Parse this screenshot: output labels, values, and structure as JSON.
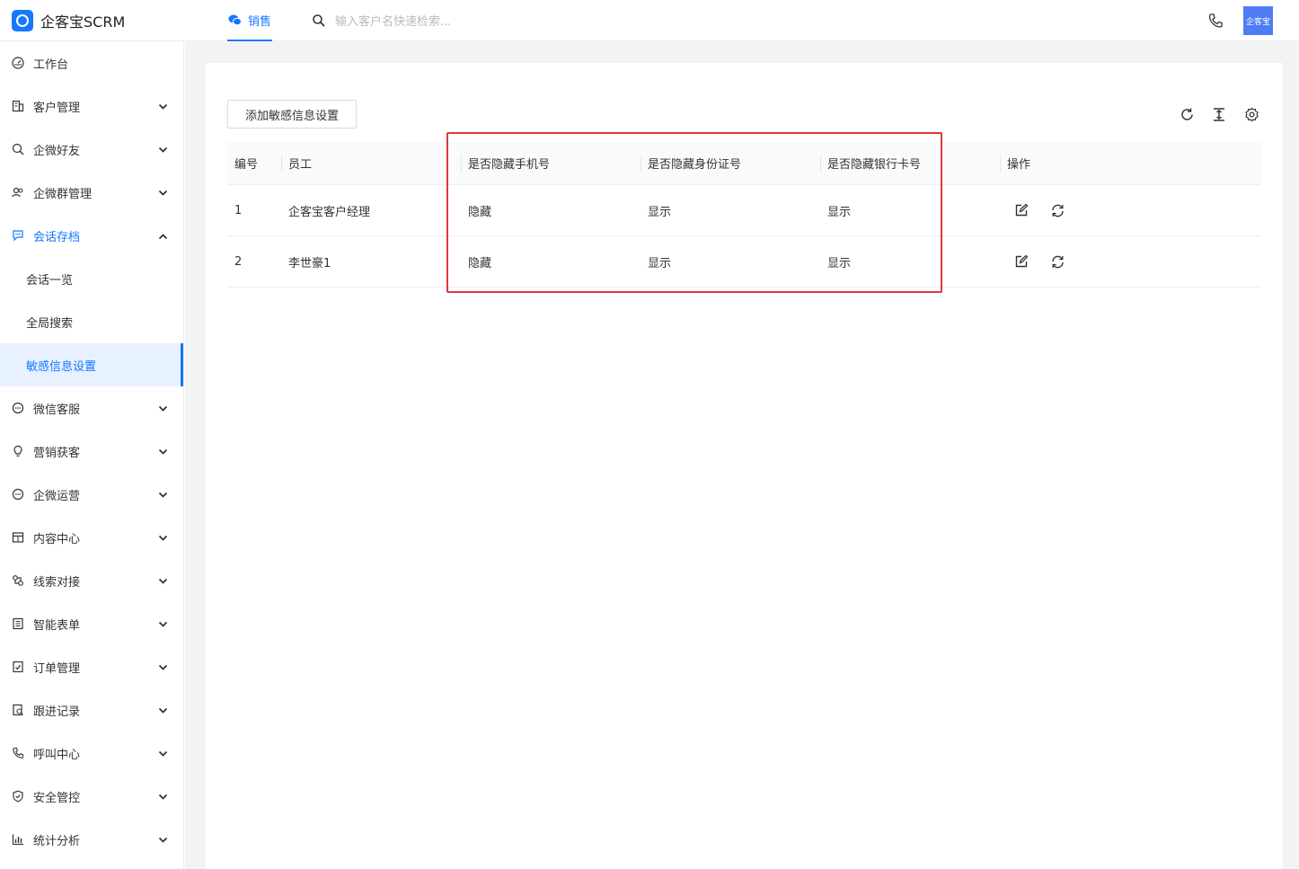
{
  "app": {
    "title": "企客宝SCRM",
    "nav_tab": "销售",
    "search_placeholder": "输入客户名快速检索...",
    "avatar_text": "企客宝",
    "accent_color": "#1677ff",
    "highlight_color": "#e0373a"
  },
  "sidebar": {
    "items": [
      {
        "label": "工作台",
        "icon": "dashboard-icon",
        "has_chevron": false
      },
      {
        "label": "客户管理",
        "icon": "building-icon",
        "has_chevron": true
      },
      {
        "label": "企微好友",
        "icon": "chat-search-icon",
        "has_chevron": true
      },
      {
        "label": "企微群管理",
        "icon": "group-icon",
        "has_chevron": true
      },
      {
        "label": "会话存档",
        "icon": "conversation-icon",
        "has_chevron": true,
        "expanded": true
      },
      {
        "label": "会话一览",
        "sub": true
      },
      {
        "label": "全局搜索",
        "sub": true
      },
      {
        "label": "敏感信息设置",
        "sub": true,
        "selected": true
      },
      {
        "label": "微信客服",
        "icon": "message-circle-icon",
        "has_chevron": true
      },
      {
        "label": "营销获客",
        "icon": "bulb-icon",
        "has_chevron": true
      },
      {
        "label": "企微运营",
        "icon": "ops-circle-icon",
        "has_chevron": true
      },
      {
        "label": "内容中心",
        "icon": "store-icon",
        "has_chevron": true
      },
      {
        "label": "线索对接",
        "icon": "link-icon",
        "has_chevron": true
      },
      {
        "label": "智能表单",
        "icon": "form-icon",
        "has_chevron": true
      },
      {
        "label": "订单管理",
        "icon": "order-icon",
        "has_chevron": true
      },
      {
        "label": "跟进记录",
        "icon": "record-icon",
        "has_chevron": true
      },
      {
        "label": "呼叫中心",
        "icon": "phone-icon",
        "has_chevron": true
      },
      {
        "label": "安全管控",
        "icon": "shield-icon",
        "has_chevron": true
      },
      {
        "label": "统计分析",
        "icon": "bar-chart-icon",
        "has_chevron": true
      }
    ]
  },
  "toolbar": {
    "add_button": "添加敏感信息设置"
  },
  "table": {
    "headers": [
      "编号",
      "员工",
      "是否隐藏手机号",
      "是否隐藏身份证号",
      "是否隐藏银行卡号",
      "操作"
    ],
    "rows": [
      [
        "1",
        "企客宝客户经理",
        "隐藏",
        "显示",
        "显示"
      ],
      [
        "2",
        "李世豪1",
        "隐藏",
        "显示",
        "显示"
      ]
    ]
  }
}
